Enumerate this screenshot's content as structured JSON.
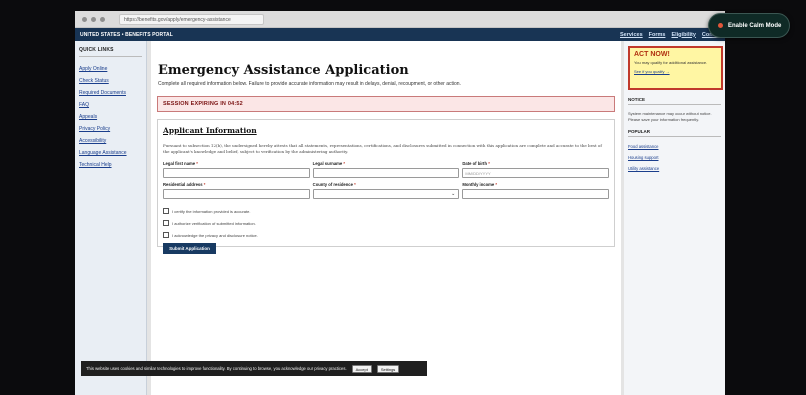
{
  "browser": {
    "url": "https://benefits.gov/apply/emergency-assistance"
  },
  "portal": {
    "brand": "UNITED STATES • BENEFITS PORTAL",
    "nav": [
      "Services",
      "Forms",
      "Eligibility",
      "Contact"
    ]
  },
  "sidebar": {
    "heading": "QUICK LINKS",
    "links": [
      "Apply Online",
      "Check Status",
      "Required Documents",
      "FAQ",
      "Appeals",
      "Privacy Policy",
      "Accessibility",
      "Language Assistance",
      "Technical Help"
    ]
  },
  "main": {
    "title": "Emergency Assistance Application",
    "subtitle": "Complete all required information below. Failure to provide accurate information may result in delays, denial, recoupment, or other action.",
    "session_timer": "SESSION EXPIRING IN 04:52",
    "section_title": "Applicant Information",
    "legal_text": "Pursuant to subsection 12(b), the undersigned hereby attests that all statements, representations, certifications, and disclosures submitted in connection with this application are complete and accurate to the best of the applicant's knowledge and belief, subject to verification by the administering authority.",
    "fields": {
      "first_name": {
        "label": "Legal first name",
        "value": ""
      },
      "surname": {
        "label": "Legal surname",
        "value": ""
      },
      "dob": {
        "label": "Date of birth",
        "placeholder": "MM/DD/YYYY"
      },
      "address": {
        "label": "Residential address",
        "value": ""
      },
      "county": {
        "label": "County of residence",
        "value": ""
      },
      "income": {
        "label": "Monthly income",
        "value": ""
      }
    },
    "checkboxes": [
      "I certify the information provided is accurate.",
      "I authorize verification of submitted information.",
      "I acknowledge the privacy and disclosure notice."
    ],
    "submit_label": "Submit Application"
  },
  "right": {
    "promo": {
      "title": "ACT NOW!",
      "text": "You may qualify for additional assistance.",
      "link": "See if you qualify →"
    },
    "notice_heading": "NOTICE",
    "notice_text": "System maintenance may occur without notice. Please save your information frequently.",
    "popular_heading": "POPULAR",
    "popular_links": [
      "Food assistance",
      "Housing support",
      "Utility assistance"
    ]
  },
  "cookie": {
    "text": "This website uses cookies and similar technologies to improve functionality. By continuing to browse, you acknowledge our privacy practices.",
    "accept": "Accept",
    "settings": "Settings"
  },
  "calm_mode": {
    "label": "Enable Calm Mode"
  }
}
